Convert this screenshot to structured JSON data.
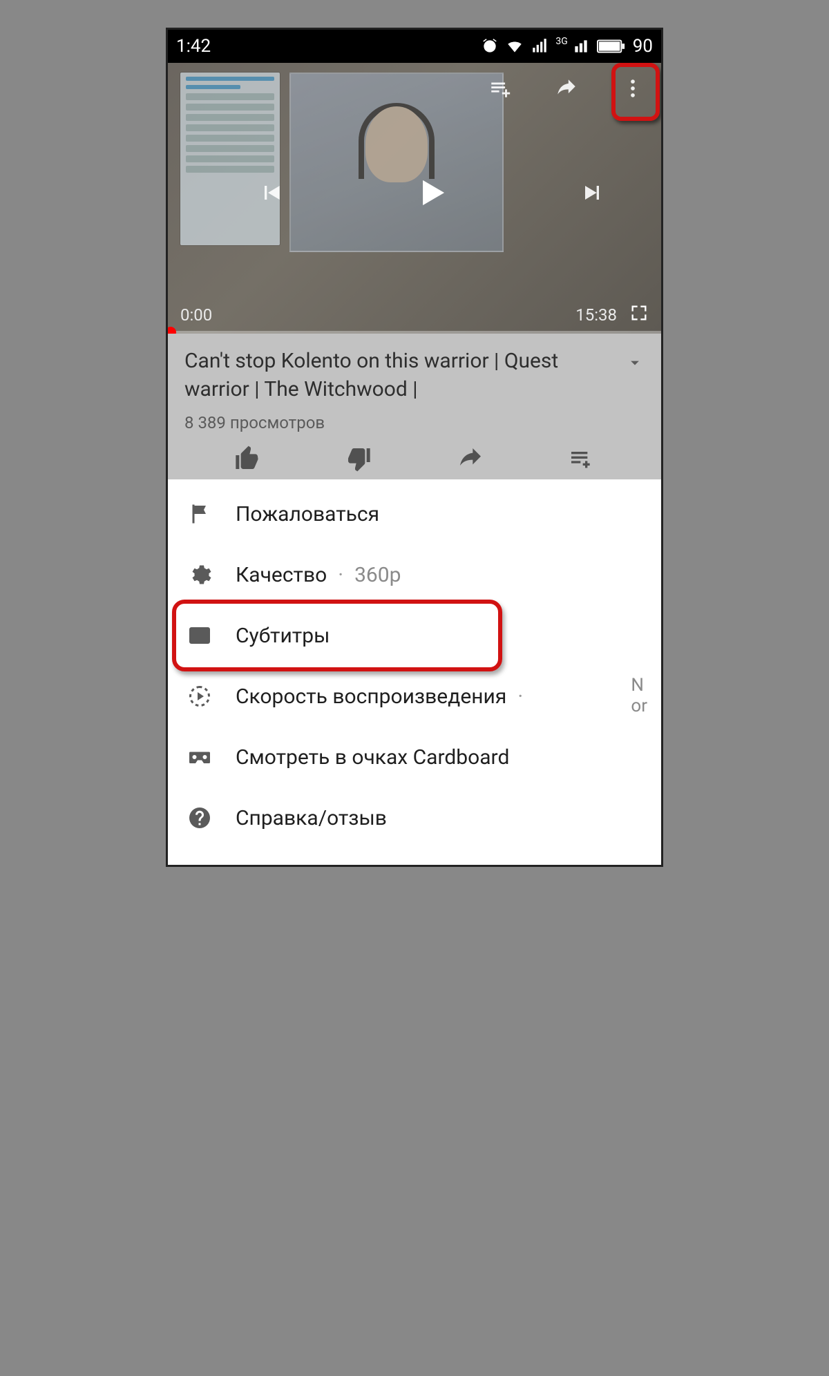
{
  "status_bar": {
    "time": "1:42",
    "network_type": "3G",
    "battery_pct": "90"
  },
  "player": {
    "current_time": "0:00",
    "duration": "15:38"
  },
  "video": {
    "title": "Can't stop Kolento on this warrior | Quest warrior | The Witchwood |",
    "views": "8 389 просмотров"
  },
  "menu": {
    "report": "Пожаловаться",
    "quality_label": "Качество",
    "quality_value": "360p",
    "captions": "Субтитры",
    "playback_speed_label": "Скорость воспроизведения",
    "playback_speed_value": "N\nor",
    "cardboard": "Смотреть в очках Cardboard",
    "help": "Справка/отзыв"
  }
}
